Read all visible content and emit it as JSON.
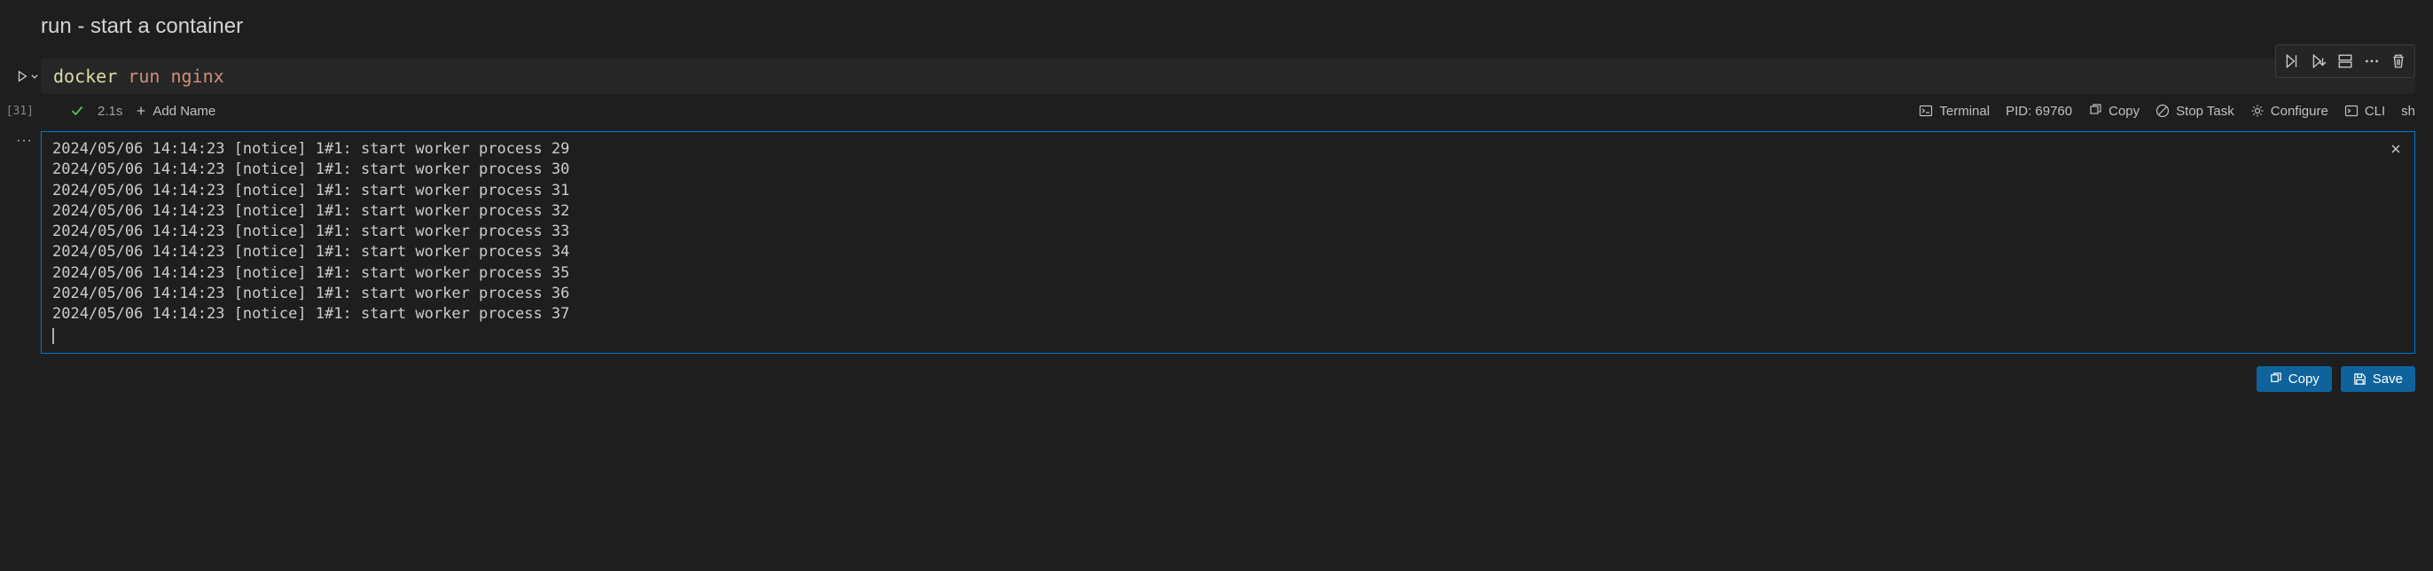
{
  "header": {
    "title": "run - start a container"
  },
  "cell": {
    "exec_count": "[31]",
    "code": {
      "cmd": "docker",
      "sub": "run",
      "arg": "nginx"
    }
  },
  "status": {
    "timing": "2.1s",
    "add_name_label": "Add Name",
    "terminal_label": "Terminal",
    "pid_label": "PID: 69760",
    "copy_label": "Copy",
    "stop_label": "Stop Task",
    "configure_label": "Configure",
    "cli_label": "CLI",
    "sh_label": "sh"
  },
  "output": {
    "lines": [
      "2024/05/06 14:14:23 [notice] 1#1: start worker process 29",
      "2024/05/06 14:14:23 [notice] 1#1: start worker process 30",
      "2024/05/06 14:14:23 [notice] 1#1: start worker process 31",
      "2024/05/06 14:14:23 [notice] 1#1: start worker process 32",
      "2024/05/06 14:14:23 [notice] 1#1: start worker process 33",
      "2024/05/06 14:14:23 [notice] 1#1: start worker process 34",
      "2024/05/06 14:14:23 [notice] 1#1: start worker process 35",
      "2024/05/06 14:14:23 [notice] 1#1: start worker process 36",
      "2024/05/06 14:14:23 [notice] 1#1: start worker process 37"
    ]
  },
  "footer": {
    "copy_label": "Copy",
    "save_label": "Save"
  }
}
